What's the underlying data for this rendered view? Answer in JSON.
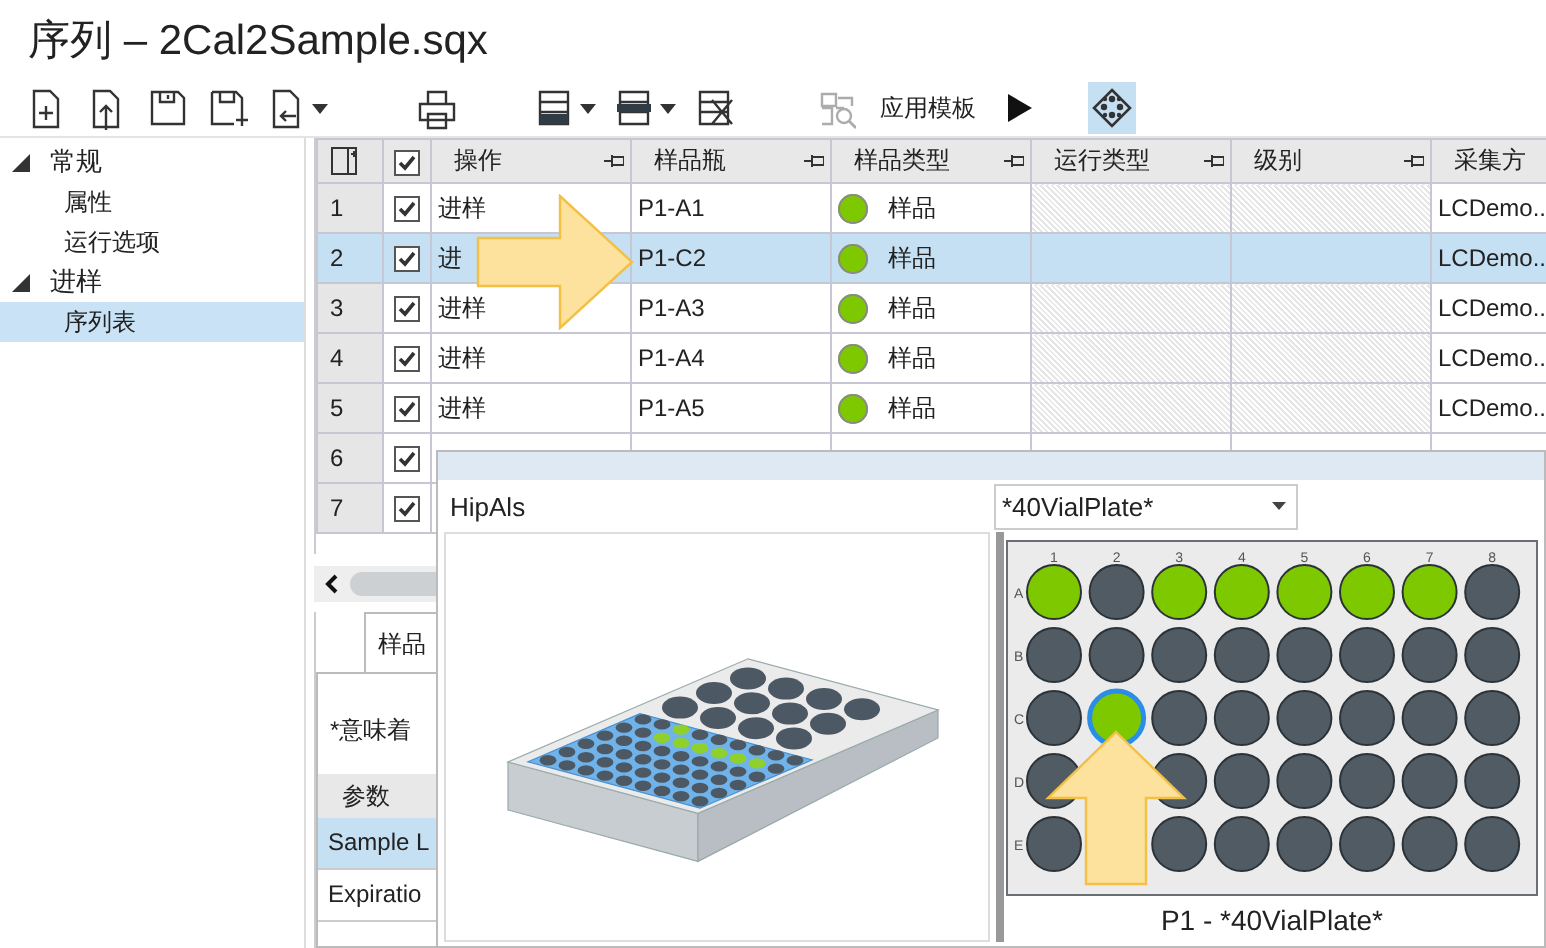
{
  "window": {
    "title": "序列 – 2Cal2Sample.sqx"
  },
  "toolbar": [
    {
      "kind": "new",
      "disabled": false,
      "menu": false,
      "on": false
    },
    {
      "kind": "import",
      "disabled": false,
      "menu": false,
      "on": false
    },
    {
      "kind": "save",
      "disabled": false,
      "menu": false,
      "on": false
    },
    {
      "kind": "save-as",
      "disabled": false,
      "menu": false,
      "on": false
    },
    {
      "kind": "export",
      "disabled": false,
      "menu": true,
      "on": false
    },
    {
      "kind": "print",
      "disabled": false,
      "menu": false,
      "on": false
    },
    {
      "kind": "insert-rows",
      "disabled": false,
      "menu": true,
      "on": false
    },
    {
      "kind": "append-rows",
      "disabled": false,
      "menu": true,
      "on": false
    },
    {
      "kind": "delete-rows",
      "disabled": false,
      "menu": false,
      "on": false
    },
    {
      "kind": "template",
      "disabled": true,
      "menu": false,
      "on": false
    },
    {
      "kind": "label",
      "text": "应用模板"
    },
    {
      "kind": "run",
      "disabled": false,
      "menu": false,
      "on": false
    },
    {
      "kind": "plate-view",
      "disabled": false,
      "menu": false,
      "on": true
    }
  ],
  "sidebar": {
    "items": [
      {
        "label": "常规",
        "expanded": true,
        "selected": false,
        "children": [
          {
            "label": "属性",
            "selected": false
          },
          {
            "label": "运行选项",
            "selected": false
          }
        ]
      },
      {
        "label": "进样",
        "expanded": true,
        "selected": false,
        "children": [
          {
            "label": "序列表",
            "selected": true
          }
        ]
      }
    ]
  },
  "table": {
    "header_checked": true,
    "columns": [
      {
        "label": "操作",
        "pinned": true
      },
      {
        "label": "样品瓶",
        "pinned": true
      },
      {
        "label": "样品类型",
        "pinned": true
      },
      {
        "label": "运行类型",
        "pinned": true
      },
      {
        "label": "级别",
        "pinned": true
      },
      {
        "label": "采集方",
        "pinned": false
      }
    ],
    "rows": [
      {
        "number": "1",
        "checked": true,
        "selected": false,
        "action": "进样",
        "vial": "P1-A1",
        "sample_type": {
          "label": "样品",
          "color": "#7ec800"
        },
        "method": "LCDemo.."
      },
      {
        "number": "2",
        "checked": true,
        "selected": true,
        "action": "进",
        "vial": "P1-C2",
        "sample_type": {
          "label": "样品",
          "color": "#7ec800"
        },
        "method": "LCDemo.."
      },
      {
        "number": "3",
        "checked": true,
        "selected": false,
        "action": "进样",
        "vial": "P1-A3",
        "sample_type": {
          "label": "样品",
          "color": "#7ec800"
        },
        "method": "LCDemo.."
      },
      {
        "number": "4",
        "checked": true,
        "selected": false,
        "action": "进样",
        "vial": "P1-A4",
        "sample_type": {
          "label": "样品",
          "color": "#7ec800"
        },
        "method": "LCDemo.."
      },
      {
        "number": "5",
        "checked": true,
        "selected": false,
        "action": "进样",
        "vial": "P1-A5",
        "sample_type": {
          "label": "样品",
          "color": "#7ec800"
        },
        "method": "LCDemo.."
      },
      {
        "number": "6",
        "checked": true,
        "selected": false
      },
      {
        "number": "7",
        "checked": true,
        "selected": false
      }
    ]
  },
  "bottom_panel": {
    "tabs": [
      {
        "label": "样品",
        "selected": true
      }
    ],
    "note": "*意味着",
    "parameters": {
      "column": "参数",
      "rows": [
        {
          "name": "Sample L",
          "selected": true
        },
        {
          "name": "Expiratio",
          "selected": false
        }
      ]
    }
  },
  "popup": {
    "module": "HipAls",
    "plate_select": "*40VialPlate*",
    "caption": "P1 - *40VialPlate*",
    "plate": {
      "columns": [
        "1",
        "2",
        "3",
        "4",
        "5",
        "6",
        "7",
        "8"
      ],
      "rows": [
        {
          "label": "A",
          "vials": [
            {
              "filled": true,
              "selected": false
            },
            {
              "filled": false,
              "selected": false
            },
            {
              "filled": true,
              "selected": false
            },
            {
              "filled": true,
              "selected": false
            },
            {
              "filled": true,
              "selected": false
            },
            {
              "filled": true,
              "selected": false
            },
            {
              "filled": true,
              "selected": false
            },
            {
              "filled": false,
              "selected": false
            }
          ]
        },
        {
          "label": "B",
          "vials": [
            {
              "filled": false,
              "selected": false
            },
            {
              "filled": false,
              "selected": false
            },
            {
              "filled": false,
              "selected": false
            },
            {
              "filled": false,
              "selected": false
            },
            {
              "filled": false,
              "selected": false
            },
            {
              "filled": false,
              "selected": false
            },
            {
              "filled": false,
              "selected": false
            },
            {
              "filled": false,
              "selected": false
            }
          ]
        },
        {
          "label": "C",
          "vials": [
            {
              "filled": false,
              "selected": false
            },
            {
              "filled": true,
              "selected": true
            },
            {
              "filled": false,
              "selected": false
            },
            {
              "filled": false,
              "selected": false
            },
            {
              "filled": false,
              "selected": false
            },
            {
              "filled": false,
              "selected": false
            },
            {
              "filled": false,
              "selected": false
            },
            {
              "filled": false,
              "selected": false
            }
          ]
        },
        {
          "label": "D",
          "vials": [
            {
              "filled": false,
              "selected": false
            },
            {
              "covered": true
            },
            {
              "filled": false,
              "selected": false
            },
            {
              "filled": false,
              "selected": false
            },
            {
              "filled": false,
              "selected": false
            },
            {
              "filled": false,
              "selected": false
            },
            {
              "filled": false,
              "selected": false
            },
            {
              "filled": false,
              "selected": false
            }
          ]
        },
        {
          "label": "E",
          "vials": [
            {
              "filled": false,
              "selected": false
            },
            {
              "covered": true
            },
            {
              "filled": false,
              "selected": false
            },
            {
              "filled": false,
              "selected": false
            },
            {
              "filled": false,
              "selected": false
            },
            {
              "filled": false,
              "selected": false
            },
            {
              "filled": false,
              "selected": false
            },
            {
              "filled": false,
              "selected": false
            }
          ]
        }
      ]
    }
  }
}
